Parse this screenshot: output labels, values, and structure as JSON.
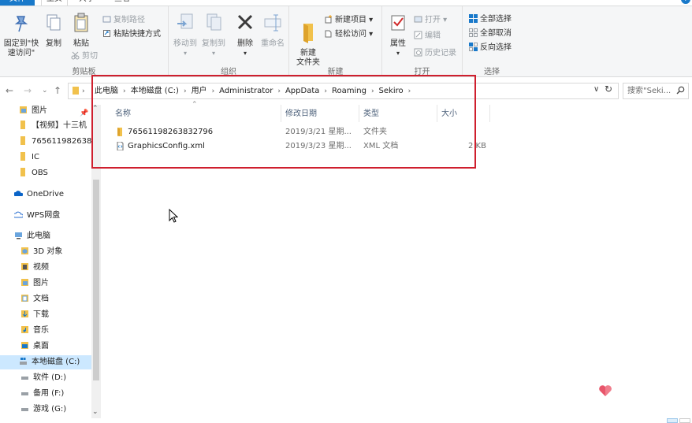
{
  "tabs": {
    "file": "文件",
    "home": "主页",
    "share": "共享",
    "view": "查看"
  },
  "ribbon": {
    "clipboard": {
      "label": "剪贴板",
      "pin": "固定到\"快速访问\"",
      "copy": "复制",
      "paste": "粘贴",
      "copy_path": "复制路径",
      "paste_shortcut": "粘贴快捷方式",
      "cut": "剪切"
    },
    "organize": {
      "label": "组织",
      "move_to": "移动到",
      "copy_to": "复制到",
      "delete": "删除",
      "rename": "重命名"
    },
    "new": {
      "label": "新建",
      "new_folder": "新建\n文件夹",
      "new_item": "新建项目 ▾",
      "easy_access": "轻松访问 ▾"
    },
    "open": {
      "label": "打开",
      "properties": "属性",
      "open": "打开 ▾",
      "edit": "编辑",
      "history": "历史记录"
    },
    "select": {
      "label": "选择",
      "select_all": "全部选择",
      "select_none": "全部取消",
      "invert": "反向选择"
    }
  },
  "address": {
    "crumbs": [
      "此电脑",
      "本地磁盘 (C:)",
      "用户",
      "Administrator",
      "AppData",
      "Roaming",
      "Sekiro"
    ],
    "search_placeholder": "搜索\"Seki..."
  },
  "nav": {
    "quick": [
      "图片",
      "【视频】十三机",
      "765611982638",
      "IC",
      "OBS"
    ],
    "onedrive": "OneDrive",
    "wps": "WPS网盘",
    "pc": "此电脑",
    "pc_items": [
      "3D 对象",
      "视频",
      "图片",
      "文档",
      "下载",
      "音乐",
      "桌面",
      "本地磁盘 (C:)",
      "软件 (D:)",
      "备用 (F:)",
      "游戏 (G:)"
    ]
  },
  "columns": {
    "name": "名称",
    "date": "修改日期",
    "type": "类型",
    "size": "大小"
  },
  "files": [
    {
      "name": "76561198263832796",
      "date": "2019/3/21 星期...",
      "type": "文件夹",
      "size": "",
      "kind": "folder"
    },
    {
      "name": "GraphicsConfig.xml",
      "date": "2019/3/23 星期...",
      "type": "XML 文档",
      "size": "2 KB",
      "kind": "xml"
    }
  ],
  "colors": {
    "accent": "#1979ca",
    "highlight": "#cf1f2e",
    "selection": "#cce8ff",
    "folder": "#f1c14c"
  }
}
